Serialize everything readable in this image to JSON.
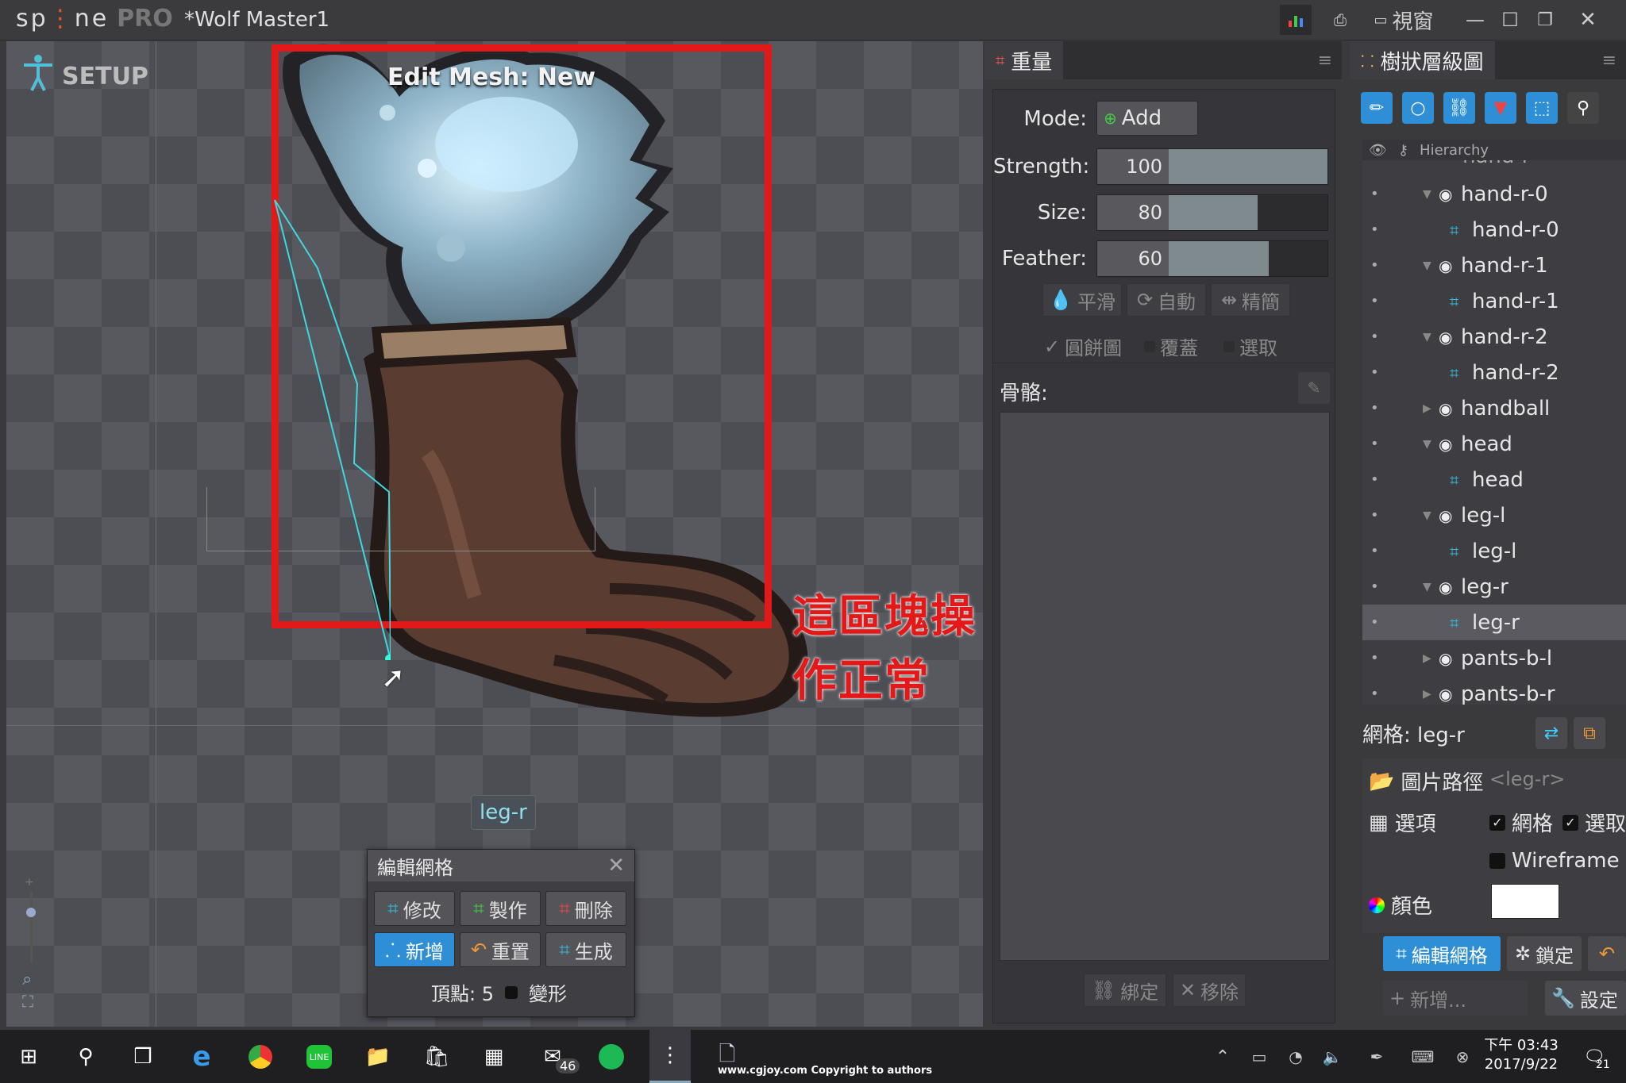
{
  "app": {
    "logo_text": "sp",
    "logo_text2": "ne",
    "edition": "PRO",
    "doc_title": "*Wolf Master1",
    "view_menu": "視窗"
  },
  "viewport": {
    "mode_label": "SETUP",
    "mesh_status": "Edit Mesh: New",
    "annotation": "這區塊操作正常",
    "attachment_tag": "leg-r"
  },
  "mesh_dialog": {
    "title": "編輯網格",
    "buttons": [
      {
        "label": "修改",
        "active": false
      },
      {
        "label": "製作",
        "active": false
      },
      {
        "label": "刪除",
        "active": false
      },
      {
        "label": "新增",
        "active": true
      },
      {
        "label": "重置",
        "active": false
      },
      {
        "label": "生成",
        "active": false
      }
    ],
    "vertices_label": "頂點: 5",
    "deform_label": "變形"
  },
  "weights": {
    "tab_title": "重量",
    "mode_label": "Mode:",
    "mode_value": "Add",
    "sliders": [
      {
        "label": "Strength:",
        "value": 100,
        "max": 100
      },
      {
        "label": "Size:",
        "value": 80,
        "max": 100
      },
      {
        "label": "Feather:",
        "value": 60,
        "max": 100
      }
    ],
    "tool_buttons": [
      "平滑",
      "自動",
      "精簡"
    ],
    "checkboxes": [
      {
        "label": "圓餅圖",
        "checked": true
      },
      {
        "label": "覆蓋",
        "checked": false
      },
      {
        "label": "選取",
        "checked": false
      }
    ],
    "bones_label": "骨骼:",
    "bottom_buttons": [
      "綁定",
      "移除"
    ]
  },
  "tree": {
    "tab_title": "樹狀層級圖",
    "column_label": "Hierarchy",
    "partial_top_item": "hand-r",
    "items": [
      {
        "label": "hand-r-0",
        "type": "bone",
        "indent": 1,
        "expanded": true
      },
      {
        "label": "hand-r-0",
        "type": "mesh",
        "indent": 2
      },
      {
        "label": "hand-r-1",
        "type": "bone",
        "indent": 1,
        "expanded": true
      },
      {
        "label": "hand-r-1",
        "type": "mesh",
        "indent": 2
      },
      {
        "label": "hand-r-2",
        "type": "bone",
        "indent": 1,
        "expanded": true
      },
      {
        "label": "hand-r-2",
        "type": "mesh",
        "indent": 2
      },
      {
        "label": "handball",
        "type": "bone",
        "indent": 1,
        "expanded": false
      },
      {
        "label": "head",
        "type": "bone",
        "indent": 1,
        "expanded": true
      },
      {
        "label": "head",
        "type": "mesh",
        "indent": 2
      },
      {
        "label": "leg-l",
        "type": "bone",
        "indent": 1,
        "expanded": true
      },
      {
        "label": "leg-l",
        "type": "mesh",
        "indent": 2
      },
      {
        "label": "leg-r",
        "type": "bone",
        "indent": 1,
        "expanded": true
      },
      {
        "label": "leg-r",
        "type": "mesh",
        "indent": 2,
        "selected": true
      },
      {
        "label": "pants-b-l",
        "type": "bone",
        "indent": 1,
        "expanded": false
      },
      {
        "label": "pants-b-r",
        "type": "bone",
        "indent": 1,
        "expanded": false
      }
    ],
    "props_title": "網格: leg-r",
    "image_path_label": "圖片路徑",
    "image_path_value": "<leg-r>",
    "options_label": "選項",
    "opt_mesh": "網格",
    "opt_select": "選取",
    "opt_wireframe": "Wireframe",
    "color_label": "顏色",
    "color_value": "#ffffff",
    "edit_mesh_button": "編輯網格",
    "lock_button": "鎖定",
    "new_button": "新增...",
    "settings_button": "設定"
  },
  "taskbar": {
    "mail_badge": "46",
    "watermark": "www.cgjoy.com Copyright to authors",
    "time": "下午 03:43",
    "date": "2017/9/22",
    "notify_badge": "21"
  },
  "colors": {
    "accent_blue": "#2e8fd6",
    "annotation_red": "#e31818",
    "mesh_line": "#3fd8e0"
  }
}
